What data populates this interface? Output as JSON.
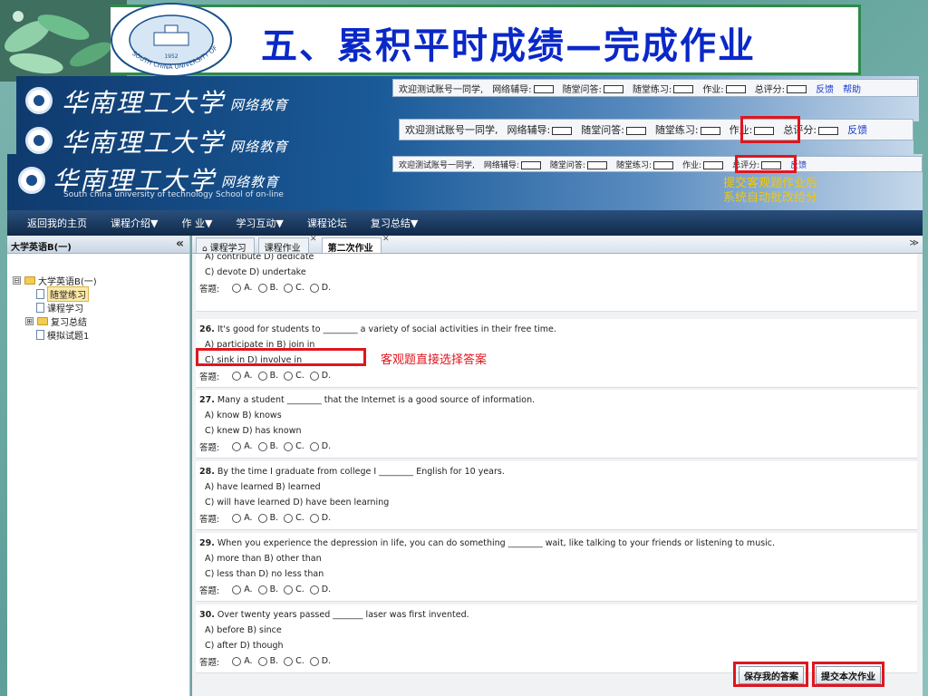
{
  "slide": {
    "title": "五、累积平时成绩—完成作业",
    "seal_caption": "SOUTH CHINA UNIVERSITY OF TECHNOLOGY"
  },
  "portal": {
    "logo_cn": "华南理工大学",
    "logo_suffix": "网络教育",
    "logo_en": "South china university of technology School of on-line",
    "status": {
      "welcome": "欢迎测试账号一同学,",
      "tutor": "网络辅导:",
      "class_qa": "随堂问答:",
      "class_practice": "随堂练习:",
      "homework": "作业:",
      "total": "总评分:",
      "feedback": "反馈",
      "help": "帮助"
    },
    "annotation_submit": [
      "提交客观题作业后",
      "系统自动批改给分"
    ],
    "annotation_choice": "客观题直接选择答案"
  },
  "nav": {
    "items": [
      "返回我的主页",
      "课程介绍▼",
      "作 业▼",
      "学习互动▼",
      "课程论坛",
      "复习总结▼"
    ]
  },
  "sidebar": {
    "header": "大学英语B(一)",
    "collapse": "«",
    "tree": [
      {
        "label": "大学英语B(一)",
        "type": "folder",
        "expander": "⊟",
        "level": 0
      },
      {
        "label": "随堂练习",
        "type": "doc",
        "selected": true,
        "level": 1
      },
      {
        "label": "课程学习",
        "type": "doc",
        "level": 1
      },
      {
        "label": "复习总结",
        "type": "folder",
        "expander": "⊞",
        "level": 1
      },
      {
        "label": "模拟试题1",
        "type": "doc",
        "level": 1
      }
    ]
  },
  "tabs": [
    {
      "label": "课程学习",
      "closable": false
    },
    {
      "label": "课程作业",
      "closable": true
    },
    {
      "label": "第二次作业",
      "closable": true,
      "active": true
    }
  ],
  "tab_menu": "≫",
  "answer_label": "答题:",
  "answer_options": [
    "A.",
    "B.",
    "C.",
    "D."
  ],
  "questions": [
    {
      "num": "",
      "stem": "",
      "opts": [
        "A) contribute  D) dedicate",
        "C) devote  D) undertake"
      ],
      "partial": true
    },
    {
      "num": "26.",
      "stem": "It's good for students to ________ a variety of social activities in their free time.",
      "opts": [
        "A) participate in  B) join in",
        "C) sink in  D) involve in"
      ]
    },
    {
      "num": "27.",
      "stem": "Many a student ________ that the Internet is a good source of information.",
      "opts": [
        "A) know  B) knows",
        "C) knew  D) has known"
      ]
    },
    {
      "num": "28.",
      "stem": "By the time I graduate from college I ________ English for 10 years.",
      "opts": [
        "A) have learned  B) learned",
        "C) will have learned  D) have been learning"
      ]
    },
    {
      "num": "29.",
      "stem": "When you experience the depression in life, you can do something ________ wait, like talking to your friends or listening to music.",
      "opts": [
        "A) more than  B) other than",
        "C) less than  D) no less than"
      ]
    },
    {
      "num": "30.",
      "stem": "Over twenty years passed _______ laser was first invented.",
      "opts": [
        "A) before  B) since",
        "C) after  D) though"
      ]
    }
  ],
  "buttons": {
    "save": "保存我的答案",
    "submit": "提交本次作业"
  },
  "colors": {
    "title": "#0a28c8",
    "highlight": "#e0161e",
    "annotation": "#f6c800",
    "nav": "#102a4a"
  }
}
